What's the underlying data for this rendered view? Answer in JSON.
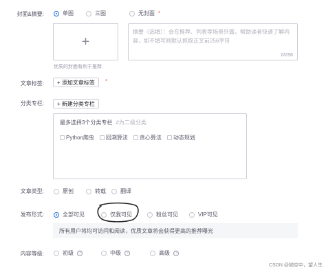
{
  "cover": {
    "label": "封面&摘要:",
    "options": [
      "单图",
      "三图",
      "无封面"
    ],
    "required_mark": "*",
    "upload_plus": "+",
    "upload_hint": "优质的封面有利于推荐",
    "summary_placeholder": "摘要（选填）：会在推荐、列表等场景外露，帮助读者快速了解内容，如不填写则默认抓取正文前256字符",
    "summary_count": "0/256"
  },
  "tags": {
    "label": "文章标签:",
    "button": "+ 添加文章标签",
    "required_mark": "*"
  },
  "category": {
    "label": "分类专栏:",
    "button": "+ 新建分类专栏",
    "prompt": "最多选择3个分类专栏",
    "hint": "#为二级分类",
    "options": [
      "Python爬虫",
      "回溯算法",
      "贪心算法",
      "动态规划"
    ]
  },
  "article_type": {
    "label": "文章类型:",
    "options": [
      "原创",
      "转载",
      "翻译"
    ]
  },
  "publish": {
    "label": "发布形式:",
    "options": [
      "全部可见",
      "仅我可见",
      "粉丝可见",
      "VIP可见"
    ],
    "note": "所有用户将均可访问和阅读，优质文章将会获得更高的推荐曝光"
  },
  "content_level": {
    "label": "内容等级:",
    "options": [
      "初级",
      "中级",
      "高级"
    ],
    "help_glyph": "?"
  },
  "watermark": "CSDN @拗空中，望人生",
  "colors": {
    "accent": "#1f6fe5",
    "required": "#fc5531",
    "border": "#ccccd8"
  }
}
